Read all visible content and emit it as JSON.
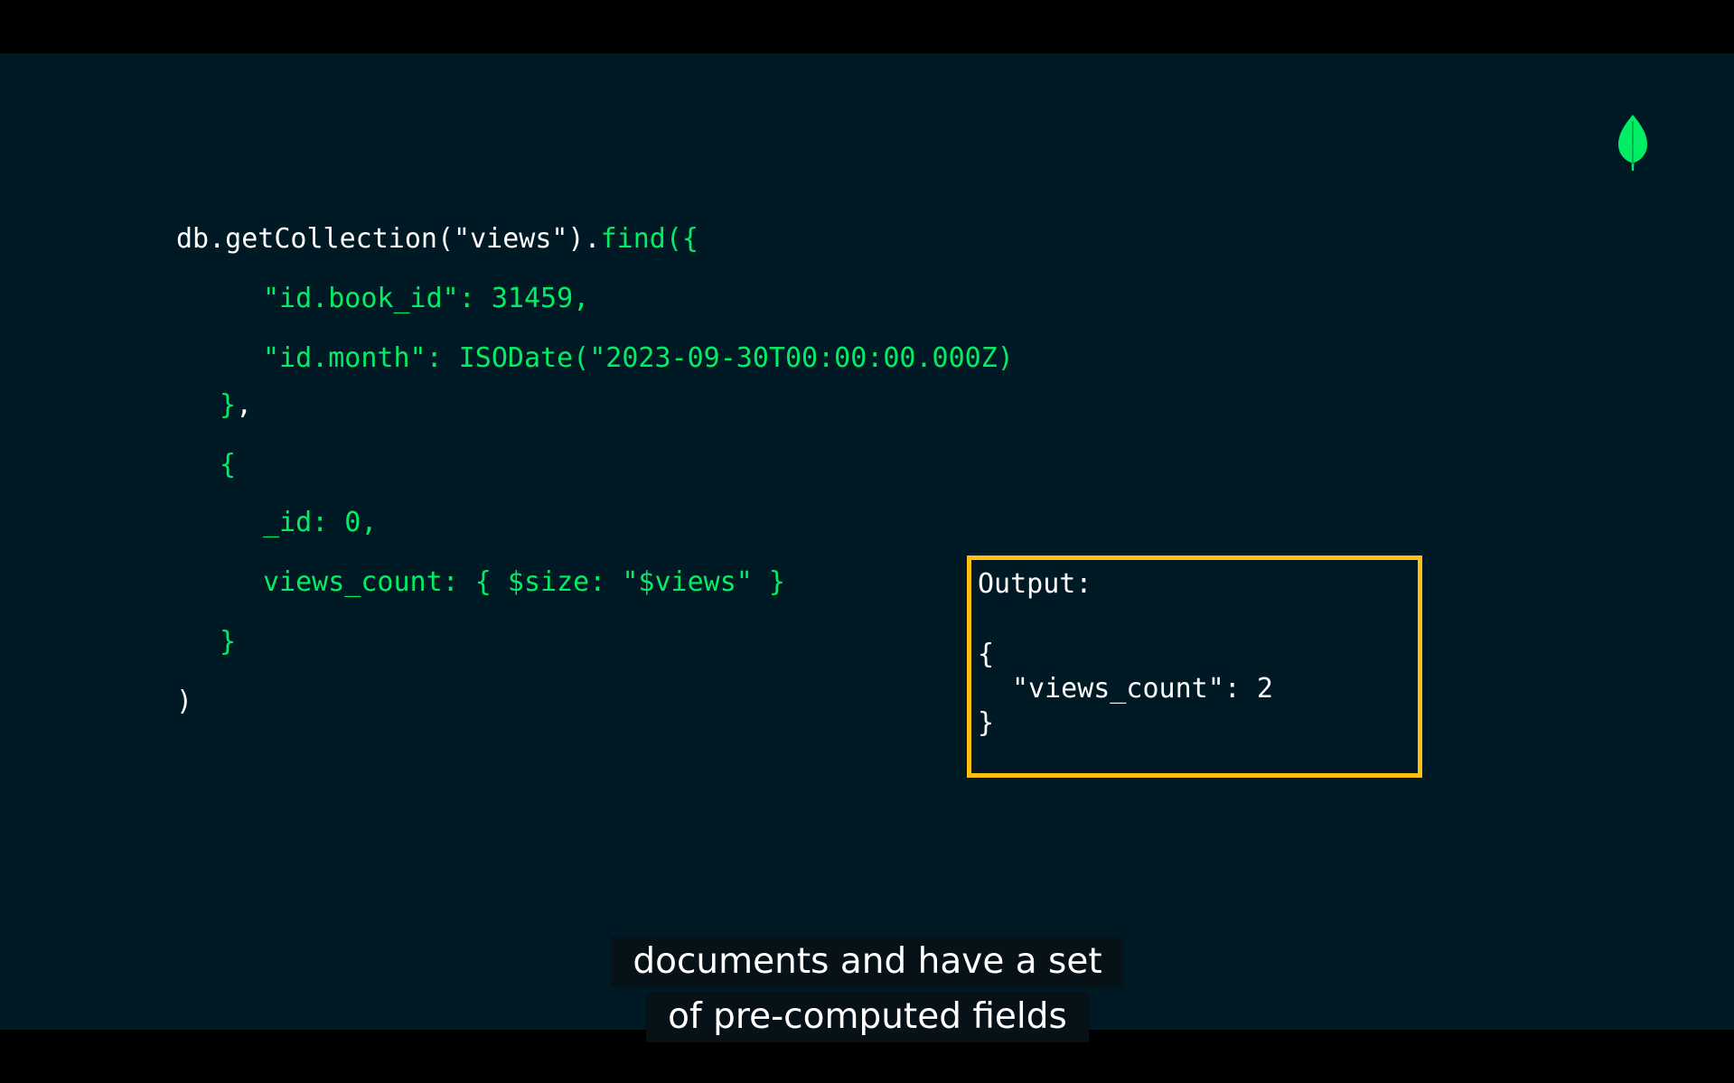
{
  "code": {
    "line1_obj": "db.getCollection(\"views\").",
    "line1_method": "find({",
    "line2": "\"id.book_id\": 31459,",
    "line3": "\"id.month\": ISODate(\"2023-09-30T00:00:00.000Z)",
    "line4_brace": "}",
    "line4_comma": ",",
    "line5": "{",
    "line6": "_id: 0,",
    "line7": "views_count: { $size: \"$views\" }",
    "line8": "}",
    "line9": ")"
  },
  "output": {
    "label": "Output:",
    "open_brace": "{",
    "field": "\"views_count\": 2",
    "close_brace": "}"
  },
  "caption": {
    "line1": "documents and have a set",
    "line2": "of pre-computed fields"
  },
  "colors": {
    "background": "#001a25",
    "code_green": "#00ed64",
    "highlight_border": "#ffc010",
    "leaf": "#00ed64"
  },
  "icons": {
    "logo": "mongodb-leaf-icon"
  }
}
